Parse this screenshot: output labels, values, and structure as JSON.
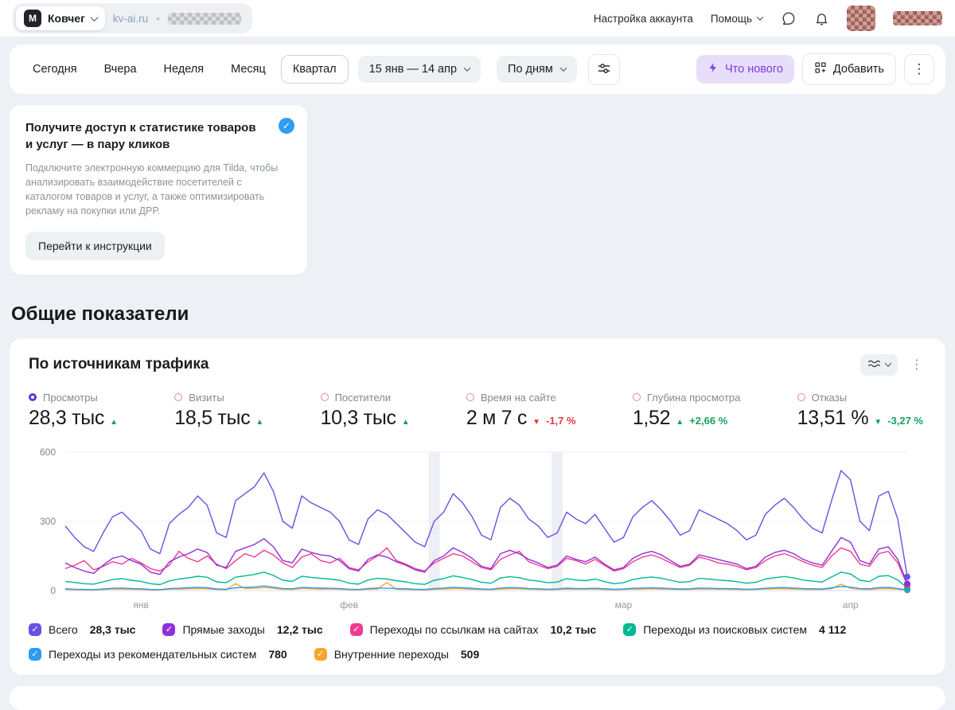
{
  "header": {
    "logo_letter": "M",
    "counter_name": "Ковчег",
    "site_domain": "kv-ai.ru",
    "separator": "•",
    "account_settings_label": "Настройка аккаунта",
    "help_label": "Помощь"
  },
  "toolbar": {
    "periods": [
      "Сегодня",
      "Вчера",
      "Неделя",
      "Месяц",
      "Квартал"
    ],
    "selected_period": "Квартал",
    "date_range": "15 янв — 14 апр",
    "granularity": "По дням",
    "whats_new_label": "Что нового",
    "add_label": "Добавить"
  },
  "promo": {
    "title": "Получите доступ к статистике товаров и услуг — в пару кликов",
    "body": "Подключите электронную коммерцию для Tilda, чтобы анализировать взаимодействие посетителей с каталогом товаров и услуг, а также оптимизировать рекламу на покупки или ДРР.",
    "button_label": "Перейти к инструкции"
  },
  "section_title": "Общие показатели",
  "widget": {
    "title": "По источникам трафика",
    "metrics": [
      {
        "label": "Просмотры",
        "value": "28,3 тыс",
        "trend": "up",
        "trend_color": "#18a05e",
        "delta": "",
        "delta_color": "",
        "selected": true
      },
      {
        "label": "Визиты",
        "value": "18,5 тыс",
        "trend": "up",
        "trend_color": "#18a05e",
        "delta": "",
        "delta_color": "",
        "selected": false
      },
      {
        "label": "Посетители",
        "value": "10,3 тыс",
        "trend": "up",
        "trend_color": "#18a05e",
        "delta": "",
        "delta_color": "",
        "selected": false
      },
      {
        "label": "Время на сайте",
        "value": "2 м 7 с",
        "trend": "down",
        "trend_color": "#e0393e",
        "delta": "-1,7 %",
        "delta_color": "#e0393e",
        "selected": false
      },
      {
        "label": "Глубина просмотра",
        "value": "1,52",
        "trend": "up",
        "trend_color": "#18a05e",
        "delta": "+2,66 %",
        "delta_color": "#18a05e",
        "selected": false
      },
      {
        "label": "Отказы",
        "value": "13,51 %",
        "trend": "down",
        "trend_color": "#18a05e",
        "delta": "-3,27 %",
        "delta_color": "#18a05e",
        "selected": false
      }
    ],
    "legend": [
      {
        "label": "Всего",
        "value": "28,3 тыс",
        "color": "#6552e3"
      },
      {
        "label": "Прямые заходы",
        "value": "12,2 тыс",
        "color": "#9130d9"
      },
      {
        "label": "Переходы по ссылкам на сайтах",
        "value": "10,2 тыс",
        "color": "#f23a8f"
      },
      {
        "label": "Переходы из поисковых систем",
        "value": "4 112",
        "color": "#00b894"
      },
      {
        "label": "Переходы из рекомендательных систем",
        "value": "780",
        "color": "#2c9bf0"
      },
      {
        "label": "Внутренние переходы",
        "value": "509",
        "color": "#f7a52b"
      }
    ]
  },
  "chart_data": {
    "type": "line",
    "title": "По источникам трафика",
    "x_range": [
      "15 янв",
      "14 апр"
    ],
    "ylim": [
      0,
      600
    ],
    "yticks": [
      0,
      300,
      600
    ],
    "xticks": [
      {
        "label": "янв",
        "day": 8
      },
      {
        "label": "фев",
        "day": 30
      },
      {
        "label": "мар",
        "day": 59
      },
      {
        "label": "апр",
        "day": 83
      }
    ],
    "holiday_band_days": [
      39,
      52
    ],
    "series": [
      {
        "name": "Всего",
        "color": "#6552e3",
        "total": "28,3 тыс",
        "values": [
          280,
          230,
          190,
          170,
          250,
          320,
          340,
          300,
          260,
          180,
          160,
          290,
          330,
          360,
          410,
          370,
          250,
          230,
          390,
          420,
          450,
          510,
          430,
          300,
          270,
          410,
          380,
          360,
          340,
          300,
          220,
          200,
          310,
          350,
          330,
          290,
          250,
          210,
          190,
          300,
          340,
          420,
          380,
          320,
          240,
          220,
          360,
          400,
          370,
          310,
          280,
          230,
          250,
          340,
          310,
          290,
          330,
          270,
          210,
          230,
          320,
          360,
          390,
          350,
          300,
          240,
          260,
          350,
          330,
          310,
          290,
          260,
          220,
          240,
          330,
          370,
          400,
          360,
          310,
          270,
          250,
          390,
          520,
          480,
          300,
          260,
          410,
          430,
          310,
          60
        ]
      },
      {
        "name": "Прямые заходы",
        "color": "#9130d9",
        "total": "12,2 тыс",
        "values": [
          120,
          100,
          85,
          75,
          110,
          140,
          150,
          130,
          115,
          80,
          70,
          125,
          145,
          160,
          180,
          165,
          110,
          100,
          170,
          185,
          200,
          225,
          190,
          130,
          120,
          180,
          165,
          155,
          150,
          130,
          95,
          85,
          135,
          155,
          145,
          125,
          110,
          90,
          80,
          130,
          150,
          185,
          165,
          140,
          105,
          95,
          160,
          175,
          160,
          135,
          120,
          100,
          110,
          150,
          135,
          125,
          145,
          115,
          90,
          100,
          140,
          160,
          170,
          155,
          130,
          105,
          115,
          155,
          145,
          135,
          125,
          115,
          95,
          105,
          145,
          165,
          175,
          160,
          135,
          120,
          110,
          170,
          230,
          210,
          130,
          115,
          180,
          190,
          135,
          30
        ]
      },
      {
        "name": "Переходы по ссылкам на сайтах",
        "color": "#f23a8f",
        "total": "10,2 тыс",
        "values": [
          95,
          110,
          130,
          90,
          105,
          125,
          115,
          140,
          120,
          95,
          85,
          110,
          170,
          140,
          125,
          150,
          115,
          95,
          130,
          160,
          145,
          175,
          155,
          120,
          100,
          145,
          160,
          130,
          120,
          140,
          100,
          90,
          125,
          150,
          185,
          130,
          115,
          95,
          85,
          120,
          140,
          160,
          150,
          125,
          100,
          90,
          135,
          155,
          170,
          125,
          110,
          95,
          105,
          140,
          130,
          115,
          135,
          110,
          85,
          95,
          125,
          145,
          155,
          140,
          120,
          100,
          110,
          145,
          135,
          120,
          115,
          105,
          90,
          100,
          130,
          150,
          160,
          145,
          125,
          110,
          100,
          150,
          185,
          170,
          115,
          105,
          160,
          170,
          120,
          25
        ]
      },
      {
        "name": "Переходы из поисковых систем",
        "color": "#00b894",
        "total": "4 112",
        "values": [
          40,
          35,
          30,
          28,
          38,
          48,
          52,
          45,
          40,
          30,
          26,
          42,
          50,
          55,
          62,
          58,
          38,
          34,
          58,
          64,
          70,
          80,
          66,
          45,
          40,
          62,
          57,
          53,
          50,
          45,
          32,
          28,
          46,
          53,
          50,
          43,
          38,
          30,
          27,
          45,
          52,
          64,
          57,
          48,
          36,
          32,
          55,
          60,
          56,
          46,
          41,
          34,
          37,
          52,
          46,
          43,
          50,
          39,
          30,
          34,
          48,
          55,
          59,
          53,
          45,
          36,
          39,
          53,
          50,
          46,
          43,
          39,
          32,
          36,
          50,
          56,
          61,
          55,
          46,
          41,
          37,
          59,
          80,
          72,
          45,
          39,
          62,
          65,
          46,
          12
        ]
      },
      {
        "name": "Переходы из рекомендательных систем",
        "color": "#2c9bf0",
        "total": "780",
        "values": [
          8,
          6,
          5,
          4,
          7,
          10,
          11,
          9,
          8,
          5,
          4,
          9,
          10,
          12,
          14,
          12,
          7,
          6,
          12,
          14,
          16,
          20,
          15,
          9,
          8,
          14,
          12,
          11,
          10,
          9,
          6,
          5,
          9,
          11,
          10,
          9,
          8,
          6,
          5,
          9,
          11,
          14,
          12,
          10,
          7,
          6,
          11,
          13,
          12,
          9,
          8,
          6,
          7,
          11,
          9,
          9,
          10,
          8,
          6,
          7,
          10,
          11,
          12,
          11,
          9,
          7,
          8,
          11,
          10,
          9,
          9,
          8,
          6,
          7,
          10,
          12,
          13,
          11,
          9,
          8,
          7,
          12,
          18,
          15,
          9,
          8,
          13,
          14,
          9,
          3
        ]
      },
      {
        "name": "Внутренние переходы",
        "color": "#f7a52b",
        "total": "509",
        "values": [
          5,
          4,
          3,
          3,
          5,
          7,
          7,
          6,
          5,
          3,
          3,
          6,
          7,
          8,
          9,
          8,
          5,
          4,
          30,
          9,
          10,
          13,
          10,
          6,
          5,
          9,
          8,
          7,
          7,
          6,
          4,
          3,
          6,
          7,
          35,
          6,
          5,
          4,
          3,
          6,
          7,
          9,
          8,
          6,
          5,
          4,
          7,
          8,
          8,
          6,
          5,
          4,
          5,
          7,
          6,
          6,
          7,
          5,
          4,
          5,
          6,
          7,
          8,
          7,
          6,
          5,
          5,
          7,
          7,
          6,
          6,
          5,
          4,
          5,
          7,
          8,
          8,
          7,
          6,
          5,
          5,
          8,
          28,
          10,
          6,
          5,
          8,
          9,
          6,
          2
        ]
      }
    ]
  }
}
